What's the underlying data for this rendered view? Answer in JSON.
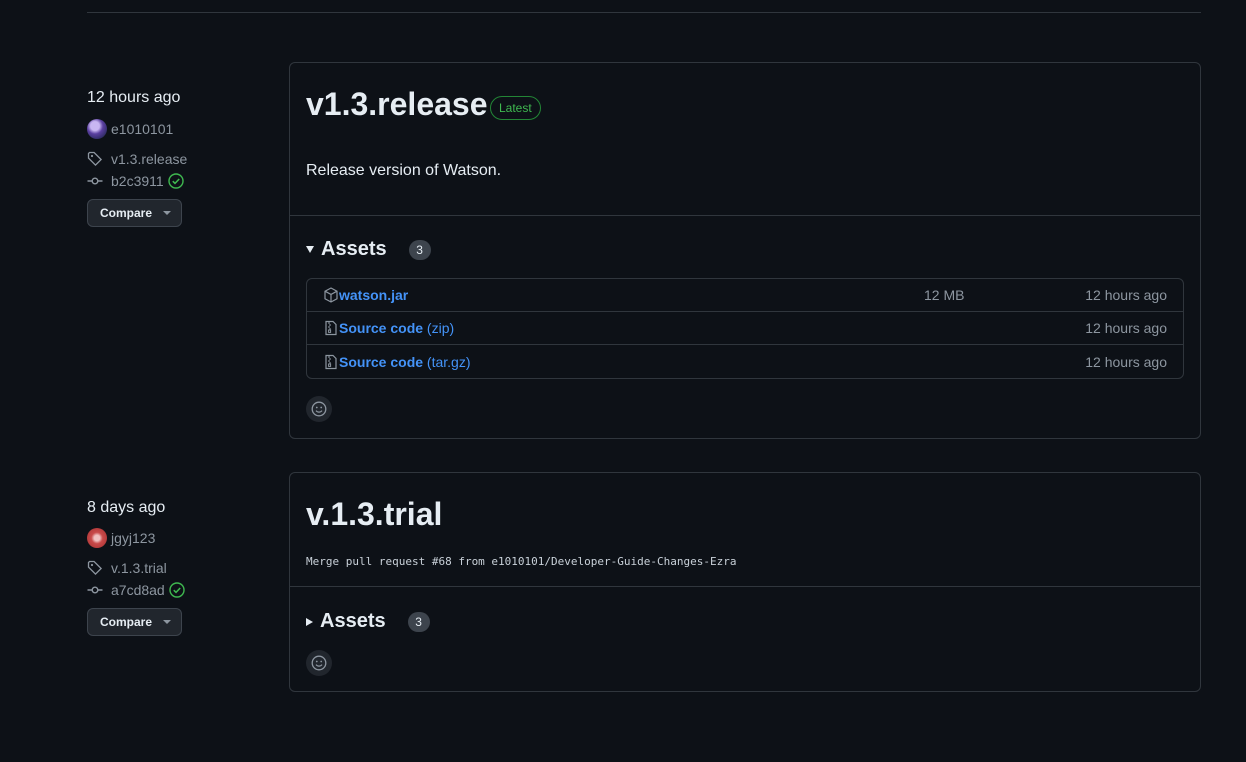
{
  "colors": {
    "bg": "#0d1117",
    "border": "#30363d",
    "link": "#4493f8",
    "success": "#3fb950",
    "muted": "#8d96a0"
  },
  "releases": [
    {
      "date": "12 hours ago",
      "author": "e1010101",
      "tag": "v1.3.release",
      "commit": "b2c3911",
      "compare_label": "Compare",
      "title": "v1.3.release",
      "badge": "Latest",
      "description": "Release version of Watson.",
      "assets_label": "Assets",
      "assets_count": "3",
      "assets_expanded": true,
      "assets": [
        {
          "icon": "package-icon",
          "name": "watson.jar",
          "suffix": "",
          "size": "12 MB",
          "time": "12 hours ago"
        },
        {
          "icon": "file-zip-icon",
          "name": "Source code",
          "suffix": " (zip)",
          "size": "",
          "time": "12 hours ago"
        },
        {
          "icon": "file-zip-icon",
          "name": "Source code",
          "suffix": " (tar.gz)",
          "size": "",
          "time": "12 hours ago"
        }
      ]
    },
    {
      "date": "8 days ago",
      "author": "jgyj123",
      "tag": "v.1.3.trial",
      "commit": "a7cd8ad",
      "compare_label": "Compare",
      "title": "v.1.3.trial",
      "description": "Merge pull request #68 from e1010101/Developer-Guide-Changes-Ezra",
      "assets_label": "Assets",
      "assets_count": "3",
      "assets_expanded": false
    }
  ]
}
